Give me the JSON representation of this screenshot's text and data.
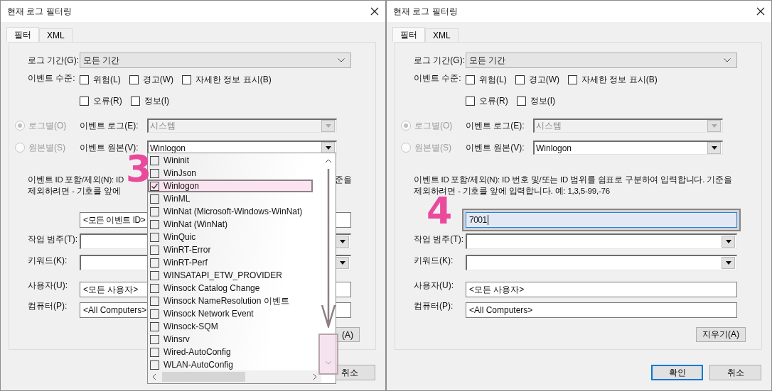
{
  "dialogs": [
    {
      "title": "현재 로그 필터링",
      "tabs": [
        {
          "label": "필터",
          "selected": true
        },
        {
          "label": "XML",
          "selected": false
        }
      ],
      "log_period": {
        "label": "로그 기간(G):",
        "value": "모든 기간"
      },
      "event_level": {
        "label": "이벤트 수준:",
        "options": [
          {
            "label": "위험(L)",
            "checked": false
          },
          {
            "label": "경고(W)",
            "checked": false
          },
          {
            "label": "자세한 정보 표시(B)",
            "checked": false
          },
          {
            "label": "오류(R)",
            "checked": false
          },
          {
            "label": "정보(I)",
            "checked": false
          }
        ]
      },
      "by_log": {
        "label": "로그별(O)",
        "selected": true,
        "disabled": true,
        "field_label": "이벤트 로그(E):",
        "value": "시스템"
      },
      "by_source": {
        "label": "원본별(S)",
        "selected": false,
        "disabled": true,
        "field_label": "이벤트 원본(V):",
        "value": "Winlogon"
      },
      "id_description": [
        "이벤트 ID 포함/제외(N): ID",
        "제외하려면 - 기호를 앞에"
      ],
      "id_description_tail": "준을",
      "event_id": {
        "value": "<모든 이벤트 ID>",
        "focused": false
      },
      "task_category": {
        "label": "작업 범주(T):"
      },
      "keyword": {
        "label": "키워드(K):"
      },
      "user": {
        "label": "사용자(U):",
        "value": "<모든 사용자>"
      },
      "computer": {
        "label": "컴퓨터(P):",
        "value": "<All Computers>"
      },
      "clear_button": "(A)",
      "buttons": [
        {
          "label": "취소",
          "kind": "cancel"
        }
      ],
      "annotation": {
        "label": "3"
      },
      "source_list": [
        {
          "label": "Wininit",
          "checked": false,
          "selected": false
        },
        {
          "label": "WinJson",
          "checked": false,
          "selected": false
        },
        {
          "label": "Winlogon",
          "checked": true,
          "selected": true
        },
        {
          "label": "WinML",
          "checked": false,
          "selected": false
        },
        {
          "label": "WinNat (Microsoft-Windows-WinNat)",
          "checked": false,
          "selected": false
        },
        {
          "label": "WinNat (WinNat)",
          "checked": false,
          "selected": false
        },
        {
          "label": "WinQuic",
          "checked": false,
          "selected": false
        },
        {
          "label": "WinRT-Error",
          "checked": false,
          "selected": false
        },
        {
          "label": "WinRT-Perf",
          "checked": false,
          "selected": false
        },
        {
          "label": "WINSATAPI_ETW_PROVIDER",
          "checked": false,
          "selected": false
        },
        {
          "label": "Winsock Catalog Change",
          "checked": false,
          "selected": false
        },
        {
          "label": "Winsock NameResolution 이벤트",
          "checked": false,
          "selected": false
        },
        {
          "label": "Winsock Network Event",
          "checked": false,
          "selected": false
        },
        {
          "label": "Winsock-SQM",
          "checked": false,
          "selected": false
        },
        {
          "label": "Winsrv",
          "checked": false,
          "selected": false
        },
        {
          "label": "Wired-AutoConfig",
          "checked": false,
          "selected": false
        },
        {
          "label": "WLAN-AutoConfig",
          "checked": false,
          "selected": false
        }
      ]
    },
    {
      "title": "현재 로그 필터링",
      "tabs": [
        {
          "label": "필터",
          "selected": true
        },
        {
          "label": "XML",
          "selected": false
        }
      ],
      "log_period": {
        "label": "로그 기간(G):",
        "value": "모든 기간"
      },
      "event_level": {
        "label": "이벤트 수준:",
        "options": [
          {
            "label": "위험(L)",
            "checked": false
          },
          {
            "label": "경고(W)",
            "checked": false
          },
          {
            "label": "자세한 정보 표시(B)",
            "checked": false
          },
          {
            "label": "오류(R)",
            "checked": false
          },
          {
            "label": "정보(I)",
            "checked": false
          }
        ]
      },
      "by_log": {
        "label": "로그별(O)",
        "selected": true,
        "disabled": true,
        "field_label": "이벤트 로그(E):",
        "value": "시스템"
      },
      "by_source": {
        "label": "원본별(S)",
        "selected": false,
        "disabled": true,
        "field_label": "이벤트 원본(V):",
        "value": "Winlogon"
      },
      "id_description": [
        "이벤트 ID 포함/제외(N): ID 번호 및/또는 ID 범위를 쉼표로 구분하여 입력합니다. 기준을",
        "제외하려면 - 기호를 앞에 입력합니다. 예: 1,3,5-99,-76"
      ],
      "event_id": {
        "value": "7001",
        "focused": true
      },
      "task_category": {
        "label": "작업 범주(T):"
      },
      "keyword": {
        "label": "키워드(K):"
      },
      "user": {
        "label": "사용자(U):",
        "value": "<모든 사용자>"
      },
      "computer": {
        "label": "컴퓨터(P):",
        "value": "<All Computers>"
      },
      "clear_button": "지우기(A)",
      "buttons": [
        {
          "label": "확인",
          "kind": "default"
        },
        {
          "label": "취소",
          "kind": "cancel"
        }
      ],
      "annotation": {
        "label": "4"
      }
    }
  ]
}
